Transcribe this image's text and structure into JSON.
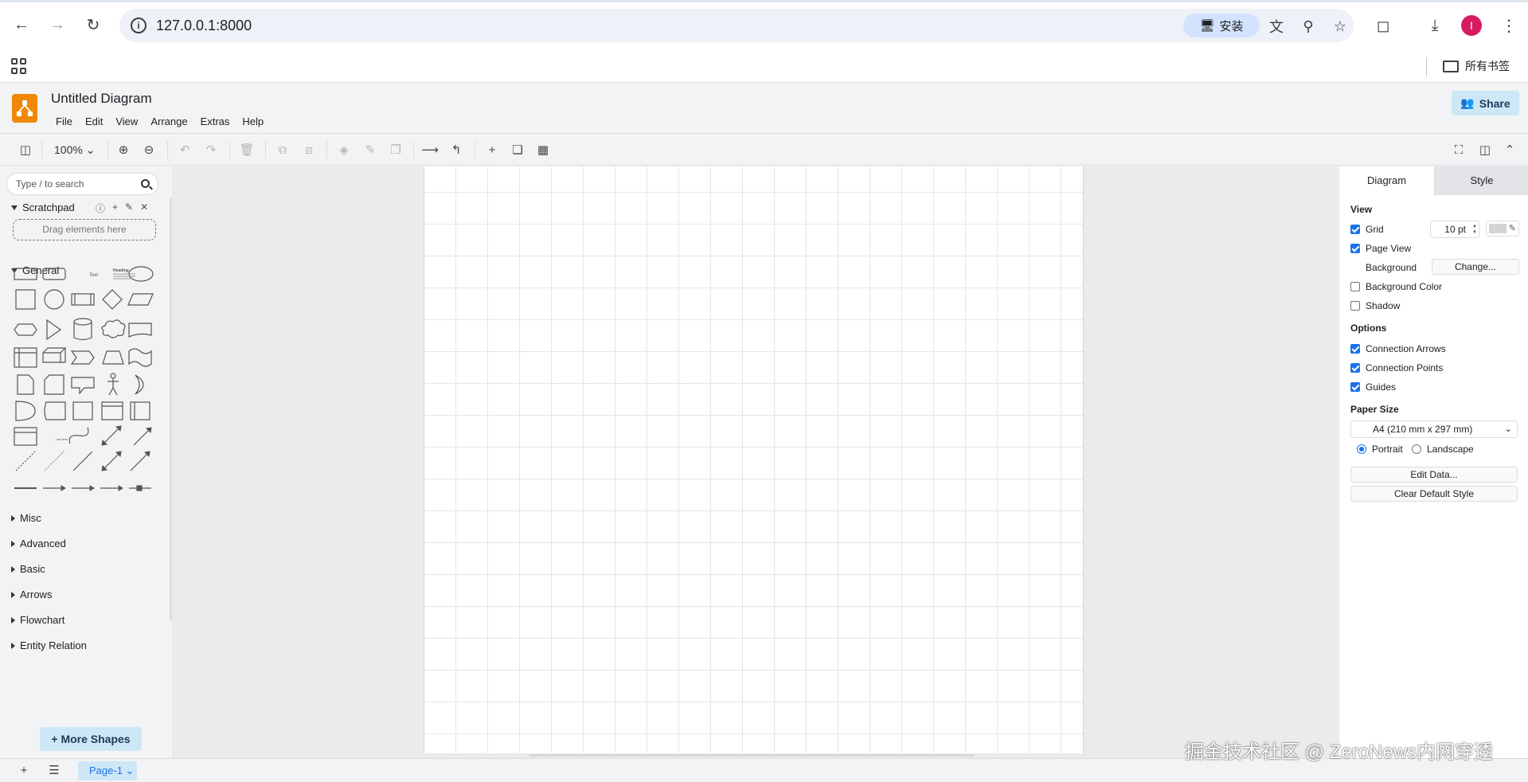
{
  "browser": {
    "url": "127.0.0.1:8000",
    "install_label": "安装",
    "avatar_letter": "I",
    "all_bookmarks": "所有书签"
  },
  "app": {
    "title": "Untitled Diagram",
    "menu": [
      "File",
      "Edit",
      "View",
      "Arrange",
      "Extras",
      "Help"
    ],
    "share_label": "Share",
    "zoom": "100%"
  },
  "sidebar": {
    "search_placeholder": "Type / to search",
    "scratchpad_label": "Scratchpad",
    "dropzone_label": "Drag elements here",
    "general_label": "General",
    "sections": [
      "Misc",
      "Advanced",
      "Basic",
      "Arrows",
      "Flowchart",
      "Entity Relation"
    ],
    "more_shapes": "+ More Shapes",
    "shape_text_label": "Text",
    "shape_heading_label": "Heading",
    "shape_list_item_label": "List Item"
  },
  "format": {
    "tabs": [
      "Diagram",
      "Style"
    ],
    "view_label": "View",
    "grid_label": "Grid",
    "grid_size": "10 pt",
    "page_view_label": "Page View",
    "background_label": "Background",
    "change_label": "Change...",
    "background_color_label": "Background Color",
    "shadow_label": "Shadow",
    "options_label": "Options",
    "connection_arrows_label": "Connection Arrows",
    "connection_points_label": "Connection Points",
    "guides_label": "Guides",
    "paper_size_label": "Paper Size",
    "paper_size_value": "A4 (210 mm x 297 mm)",
    "portrait_label": "Portrait",
    "landscape_label": "Landscape",
    "edit_data_label": "Edit Data...",
    "clear_default_style_label": "Clear Default Style",
    "checks": {
      "grid": true,
      "page_view": true,
      "background_color": false,
      "shadow": false,
      "connection_arrows": true,
      "connection_points": true,
      "guides": true
    },
    "orientation": "portrait"
  },
  "footer": {
    "page_tab": "Page-1"
  },
  "watermark": "掘金技术社区 @ ZeroNews内网穿透",
  "colors": {
    "accent": "#1a73e8",
    "logo": "#f08705",
    "share_bg": "#cee7f7"
  }
}
